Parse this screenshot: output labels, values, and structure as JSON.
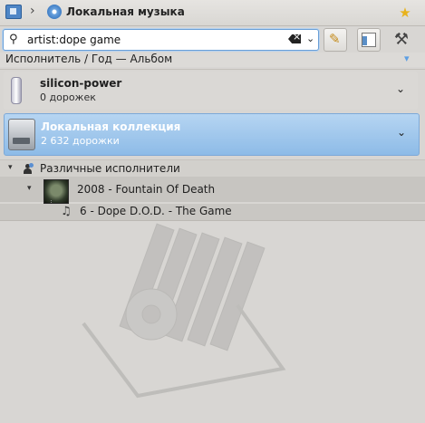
{
  "breadcrumb": {
    "title": "Локальная музыка"
  },
  "search": {
    "value": "artist:dope game"
  },
  "levels": {
    "label": "Исполнитель / Год — Альбом"
  },
  "collections": [
    {
      "name": "silicon-power",
      "count": "0 дорожек"
    },
    {
      "name": "Локальная коллекция",
      "count": "2 632 дорожки"
    }
  ],
  "tree": {
    "artist_group": "Различные исполнители",
    "album": "2008 - Fountain Of Death",
    "track": "6 - Dope D.O.D. - The Game"
  },
  "colors": {
    "selection": "#8dbbe7",
    "background": "#d8d6d3"
  }
}
